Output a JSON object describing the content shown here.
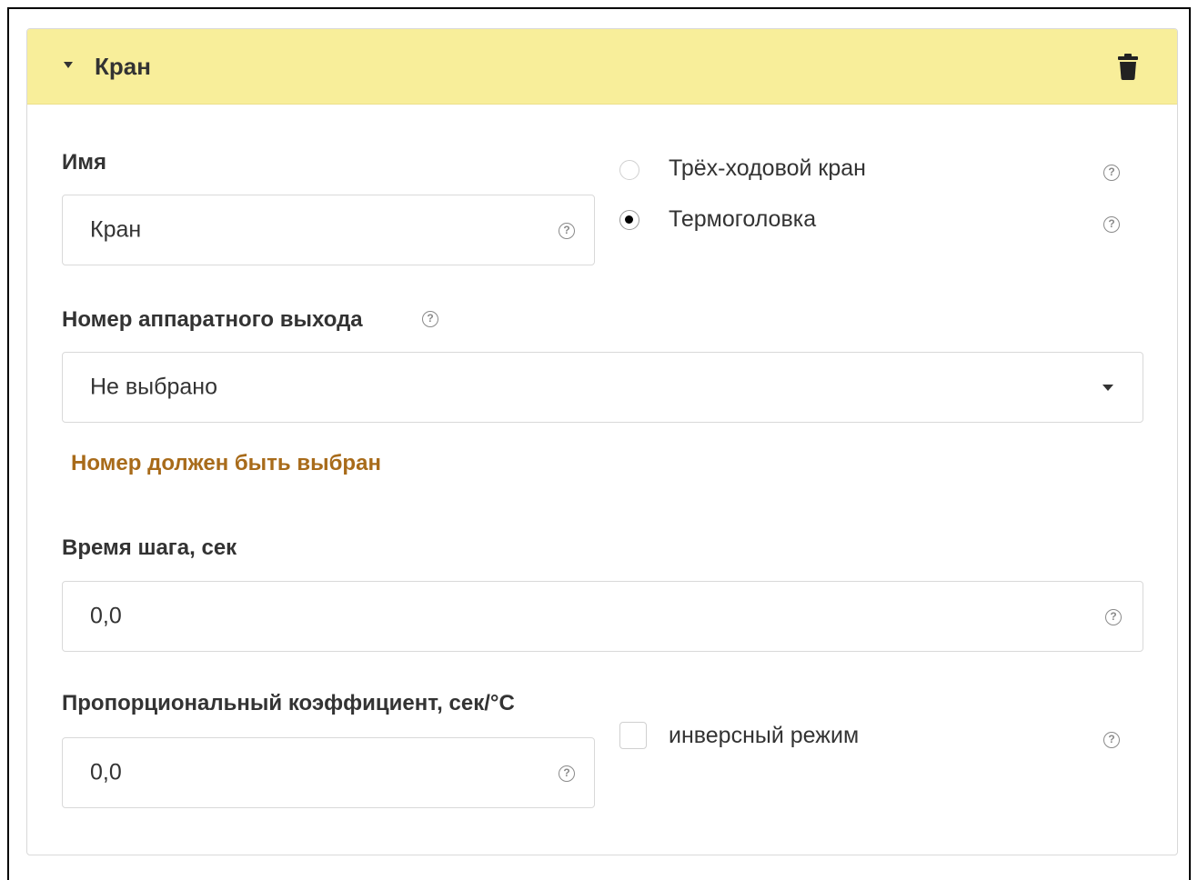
{
  "panel": {
    "title": "Кран",
    "collapse_icon": "caret-down-icon",
    "delete_icon": "trash-icon",
    "header_color": "#f8ee9a"
  },
  "name_field": {
    "label": "Имя",
    "value": "Кран",
    "help": "?"
  },
  "valve_type": {
    "options": [
      {
        "label": "Трёх-ходовой кран",
        "selected": false,
        "help": "?"
      },
      {
        "label": "Термоголовка",
        "selected": true,
        "help": "?"
      }
    ]
  },
  "output_number": {
    "label": "Номер аппаратного выхода",
    "help": "?",
    "selected": "Не выбрано",
    "error": "Номер должен быть выбран",
    "error_color": "#a86b1a"
  },
  "step_time": {
    "label": "Время шага, сек",
    "value": "0,0",
    "help": "?"
  },
  "proportional": {
    "label": "Пропорциональный коэффициент, сек/°C",
    "value": "0,0",
    "help": "?"
  },
  "inverse_mode": {
    "label": "инверсный режим",
    "checked": false,
    "help": "?"
  }
}
